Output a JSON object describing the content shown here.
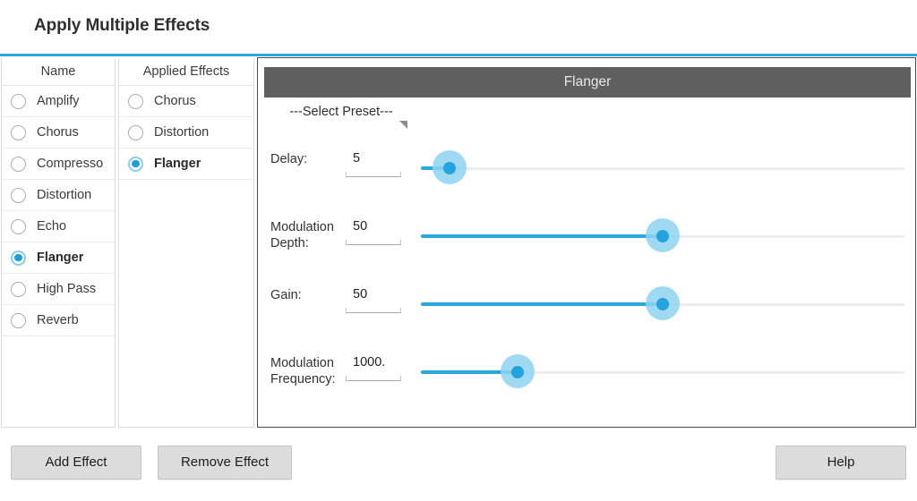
{
  "window": {
    "title": "Apply Multiple Effects",
    "accent_color": "#29a8e0"
  },
  "name_list": {
    "header": "Name",
    "items": [
      {
        "label": "Amplify",
        "selected": false
      },
      {
        "label": "Chorus",
        "selected": false
      },
      {
        "label": "Compresso",
        "selected": false
      },
      {
        "label": "Distortion",
        "selected": false
      },
      {
        "label": "Echo",
        "selected": false
      },
      {
        "label": "Flanger",
        "selected": true
      },
      {
        "label": "High Pass",
        "selected": false
      },
      {
        "label": "Reverb",
        "selected": false
      }
    ]
  },
  "applied_list": {
    "header": "Applied Effects",
    "items": [
      {
        "label": "Chorus",
        "selected": false
      },
      {
        "label": "Distortion",
        "selected": false
      },
      {
        "label": "Flanger",
        "selected": true
      }
    ]
  },
  "detail": {
    "title": "Flanger",
    "title_bar_color": "#5f5f5f",
    "preset": {
      "selected_label": "---Select Preset---",
      "arrow_icon": "triangle-down-icon"
    },
    "params": [
      {
        "label": "Delay:",
        "value": "5",
        "percent": 6
      },
      {
        "label": "Modulation Depth:",
        "label_line1": "Modulation",
        "label_line2": "Depth:",
        "value": "50",
        "percent": 50
      },
      {
        "label": "Gain:",
        "value": "50",
        "percent": 50
      },
      {
        "label": "Modulation Frequency:",
        "label_line1": "Modulation",
        "label_line2": "Frequency:",
        "value": "1000.",
        "percent": 20
      }
    ]
  },
  "buttons": {
    "add_effect": "Add Effect",
    "remove_effect": "Remove Effect",
    "help": "Help"
  }
}
